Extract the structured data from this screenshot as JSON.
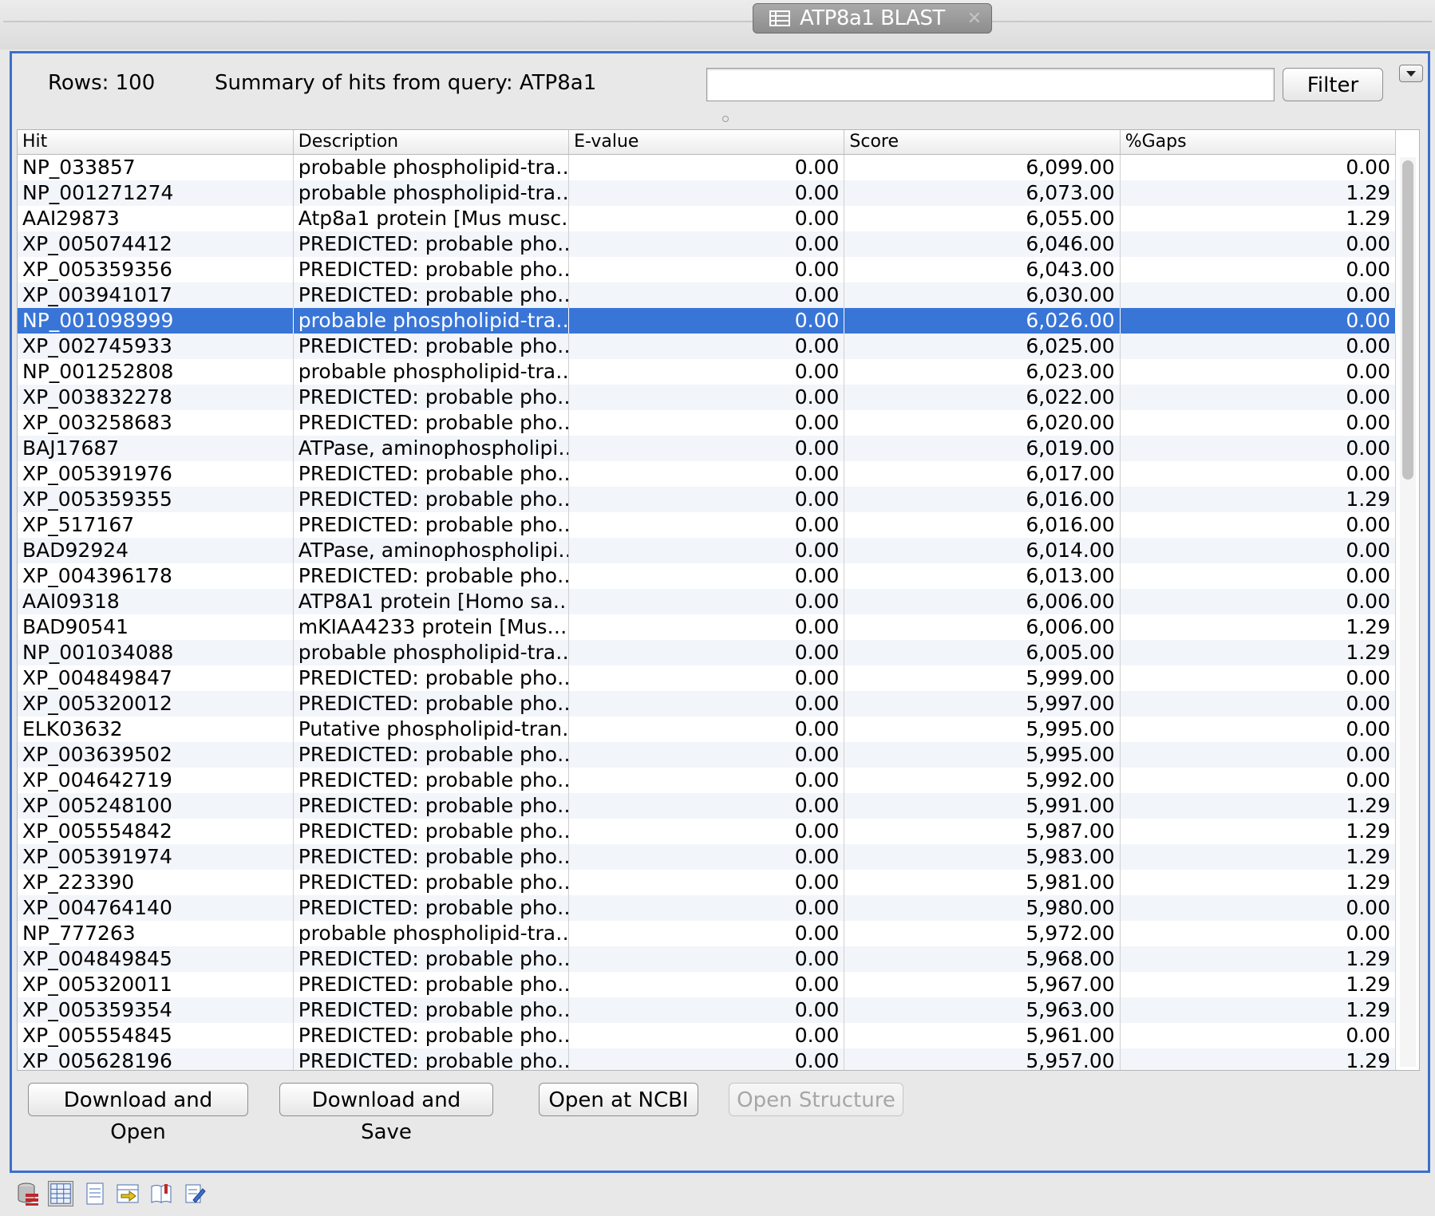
{
  "window": {
    "tab_title": "ATP8a1 BLAST",
    "tab_icon": "table-icon",
    "tab_close": "✕"
  },
  "header": {
    "rows_label": "Rows: 100",
    "summary": "Summary of hits from query: ATP8a1",
    "filter_value": "",
    "filter_button": "Filter",
    "menu_icon": "chevron-down-icon"
  },
  "table": {
    "columns": [
      "Hit",
      "Description",
      "E-value",
      "Score",
      "%Gaps"
    ],
    "selected_row": 6,
    "rows": [
      [
        "NP_033857",
        "probable phospholipid-tra…",
        "0.00",
        "6,099.00",
        "0.00"
      ],
      [
        "NP_001271274",
        "probable phospholipid-tra…",
        "0.00",
        "6,073.00",
        "1.29"
      ],
      [
        "AAI29873",
        "Atp8a1 protein [Mus musc…",
        "0.00",
        "6,055.00",
        "1.29"
      ],
      [
        "XP_005074412",
        "PREDICTED: probable pho…",
        "0.00",
        "6,046.00",
        "0.00"
      ],
      [
        "XP_005359356",
        "PREDICTED: probable pho…",
        "0.00",
        "6,043.00",
        "0.00"
      ],
      [
        "XP_003941017",
        "PREDICTED: probable pho…",
        "0.00",
        "6,030.00",
        "0.00"
      ],
      [
        "NP_001098999",
        "probable phospholipid-tra…",
        "0.00",
        "6,026.00",
        "0.00"
      ],
      [
        "XP_002745933",
        "PREDICTED: probable pho…",
        "0.00",
        "6,025.00",
        "0.00"
      ],
      [
        "NP_001252808",
        "probable phospholipid-tra…",
        "0.00",
        "6,023.00",
        "0.00"
      ],
      [
        "XP_003832278",
        "PREDICTED: probable pho…",
        "0.00",
        "6,022.00",
        "0.00"
      ],
      [
        "XP_003258683",
        "PREDICTED: probable pho…",
        "0.00",
        "6,020.00",
        "0.00"
      ],
      [
        "BAJ17687",
        "ATPase, aminophospholipi…",
        "0.00",
        "6,019.00",
        "0.00"
      ],
      [
        "XP_005391976",
        "PREDICTED: probable pho…",
        "0.00",
        "6,017.00",
        "0.00"
      ],
      [
        "XP_005359355",
        "PREDICTED: probable pho…",
        "0.00",
        "6,016.00",
        "1.29"
      ],
      [
        "XP_517167",
        "PREDICTED: probable pho…",
        "0.00",
        "6,016.00",
        "0.00"
      ],
      [
        "BAD92924",
        "ATPase, aminophospholipi…",
        "0.00",
        "6,014.00",
        "0.00"
      ],
      [
        "XP_004396178",
        "PREDICTED: probable pho…",
        "0.00",
        "6,013.00",
        "0.00"
      ],
      [
        "AAI09318",
        "ATP8A1 protein [Homo sa…",
        "0.00",
        "6,006.00",
        "0.00"
      ],
      [
        "BAD90541",
        "mKIAA4233 protein [Mus…",
        "0.00",
        "6,006.00",
        "1.29"
      ],
      [
        "NP_001034088",
        "probable phospholipid-tra…",
        "0.00",
        "6,005.00",
        "1.29"
      ],
      [
        "XP_004849847",
        "PREDICTED: probable pho…",
        "0.00",
        "5,999.00",
        "0.00"
      ],
      [
        "XP_005320012",
        "PREDICTED: probable pho…",
        "0.00",
        "5,997.00",
        "0.00"
      ],
      [
        "ELK03632",
        "Putative phospholipid-tran…",
        "0.00",
        "5,995.00",
        "0.00"
      ],
      [
        "XP_003639502",
        "PREDICTED: probable pho…",
        "0.00",
        "5,995.00",
        "0.00"
      ],
      [
        "XP_004642719",
        "PREDICTED: probable pho…",
        "0.00",
        "5,992.00",
        "0.00"
      ],
      [
        "XP_005248100",
        "PREDICTED: probable pho…",
        "0.00",
        "5,991.00",
        "1.29"
      ],
      [
        "XP_005554842",
        "PREDICTED: probable pho…",
        "0.00",
        "5,987.00",
        "1.29"
      ],
      [
        "XP_005391974",
        "PREDICTED: probable pho…",
        "0.00",
        "5,983.00",
        "1.29"
      ],
      [
        "XP_223390",
        "PREDICTED: probable pho…",
        "0.00",
        "5,981.00",
        "1.29"
      ],
      [
        "XP_004764140",
        "PREDICTED: probable pho…",
        "0.00",
        "5,980.00",
        "0.00"
      ],
      [
        "NP_777263",
        "probable phospholipid-tra…",
        "0.00",
        "5,972.00",
        "0.00"
      ],
      [
        "XP_004849845",
        "PREDICTED: probable pho…",
        "0.00",
        "5,968.00",
        "1.29"
      ],
      [
        "XP_005320011",
        "PREDICTED: probable pho…",
        "0.00",
        "5,967.00",
        "1.29"
      ],
      [
        "XP_005359354",
        "PREDICTED: probable pho…",
        "0.00",
        "5,963.00",
        "1.29"
      ],
      [
        "XP_005554845",
        "PREDICTED: probable pho…",
        "0.00",
        "5,961.00",
        "0.00"
      ],
      [
        "XP_005628196",
        "PREDICTED: probable pho…",
        "0.00",
        "5,957.00",
        "1.29"
      ]
    ]
  },
  "actions": {
    "download_open": "Download and Open",
    "download_save": "Download and Save",
    "open_ncbi": "Open at NCBI",
    "open_structure": "Open Structure"
  },
  "toolbar": {
    "icons": [
      "database-icon",
      "table-view-icon",
      "text-view-icon",
      "export-icon",
      "book-icon",
      "edit-document-icon"
    ],
    "active_index": 1
  },
  "colors": {
    "selection": "#3875d7",
    "panel_border": "#3b6fcc"
  }
}
